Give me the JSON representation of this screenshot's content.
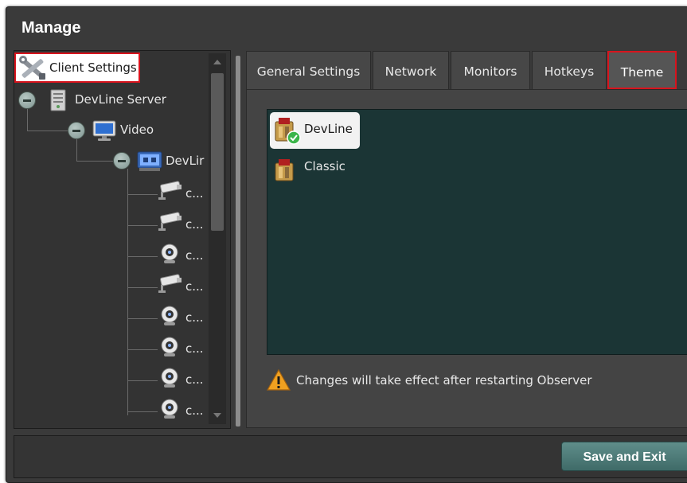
{
  "window": {
    "title": "Manage"
  },
  "tree": {
    "items": [
      {
        "label": "Client Settings",
        "icon": "tools-icon"
      },
      {
        "label": "DevLine Server",
        "icon": "server-icon"
      },
      {
        "label": "Video",
        "icon": "monitor-icon"
      },
      {
        "label": "DevLir",
        "icon": "dvr-icon"
      },
      {
        "label": "c...",
        "icon": "camera-icon"
      },
      {
        "label": "c...",
        "icon": "camera-icon"
      },
      {
        "label": "c...",
        "icon": "webcam-icon"
      },
      {
        "label": "c...",
        "icon": "camera-icon"
      },
      {
        "label": "c...",
        "icon": "webcam-icon"
      },
      {
        "label": "c...",
        "icon": "webcam-icon"
      },
      {
        "label": "c...",
        "icon": "webcam-icon"
      },
      {
        "label": "c...",
        "icon": "webcam-icon"
      }
    ]
  },
  "tabs": [
    {
      "label": "General Settings"
    },
    {
      "label": "Network"
    },
    {
      "label": "Monitors"
    },
    {
      "label": "Hotkeys"
    },
    {
      "label": "Theme",
      "active": true
    }
  ],
  "themes": [
    {
      "label": "DevLine",
      "selected": true
    },
    {
      "label": "Classic",
      "selected": false
    }
  ],
  "warning": {
    "text": "Changes will take effect after restarting Observer",
    "icon": "warning-icon"
  },
  "footer": {
    "save_exit_label": "Save and Exit"
  },
  "colors": {
    "highlight_border": "#d8141d",
    "window_bg": "#3a3a3a",
    "list_bg": "#1b3535",
    "accent_button": "#4f7d7a"
  }
}
